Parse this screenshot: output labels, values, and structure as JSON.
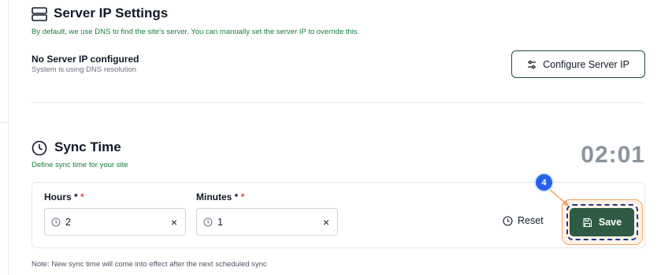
{
  "server_ip": {
    "title": "Server IP Settings",
    "description": "By default, we use DNS to find the site's server. You can manually set the server IP to override this.",
    "status_title": "No Server IP configured",
    "status_subtitle": "System is using DNS resolution",
    "configure_button": "Configure Server IP"
  },
  "sync_time": {
    "title": "Sync Time",
    "description": "Define sync time for your site",
    "clock_display": "02:01",
    "hours_label": "Hours *",
    "hours_required_mark": "*",
    "hours_value": "2",
    "minutes_label": "Minutes *",
    "minutes_required_mark": "*",
    "minutes_value": "1",
    "clear_glyph": "×",
    "reset_label": "Reset",
    "save_label": "Save",
    "note": "Note: New sync time will come into effect after the next scheduled sync"
  },
  "annotation": {
    "step_number": "4"
  },
  "icons": [
    "server-icon",
    "sliders-icon",
    "clock-icon",
    "close-icon",
    "save-icon"
  ],
  "colors": {
    "accent_green": "#2f5a44",
    "description_green": "#15803d",
    "required_red": "#ef4444",
    "step_badge": "#2563eb",
    "highlight_orange": "#f6a560"
  }
}
